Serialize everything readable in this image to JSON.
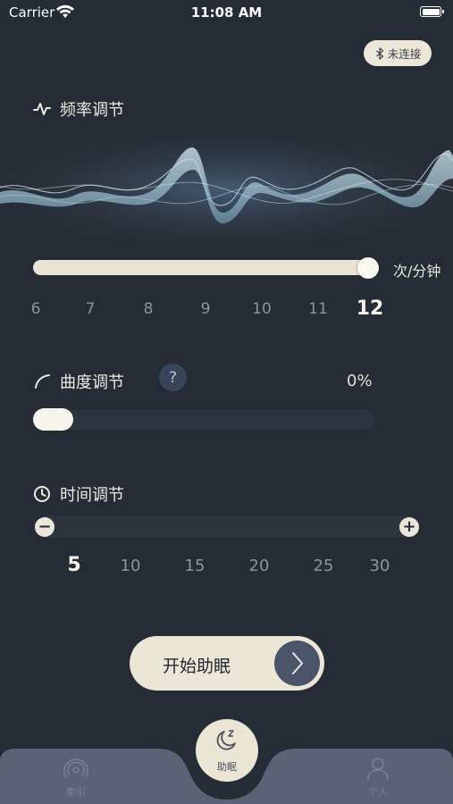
{
  "status_bar": {
    "carrier": "Carrier",
    "time": "11:08 AM"
  },
  "connection": {
    "label": "未连接",
    "icon": "bluetooth-icon"
  },
  "frequency": {
    "title": "频率调节",
    "icon": "pulse-icon",
    "unit": "次/分钟",
    "value": 12,
    "ticks": [
      "6",
      "7",
      "8",
      "9",
      "10",
      "11",
      "12"
    ],
    "selected_tick": "12"
  },
  "curvature": {
    "title": "曲度调节",
    "icon": "curve-icon",
    "help_label": "?",
    "value_label": "0%",
    "value": 0
  },
  "duration": {
    "title": "时间调节",
    "icon": "clock-icon",
    "minus_label": "−",
    "plus_label": "+",
    "ticks": [
      "5",
      "10",
      "15",
      "20",
      "25",
      "30"
    ],
    "selected_tick": "5"
  },
  "start_button": {
    "label": "开始助眠",
    "icon": "chevron-right-icon"
  },
  "tab_bar": {
    "tabs": [
      {
        "label": "牵引",
        "icon": "traction-icon",
        "active": false
      },
      {
        "label": "助眠",
        "icon": "moon-sleep-icon",
        "active": true
      },
      {
        "label": "个人",
        "icon": "person-icon",
        "active": false
      }
    ]
  },
  "colors": {
    "background": "#262c35",
    "accent": "#ece6d7",
    "tab_bar": "#5c6275"
  }
}
